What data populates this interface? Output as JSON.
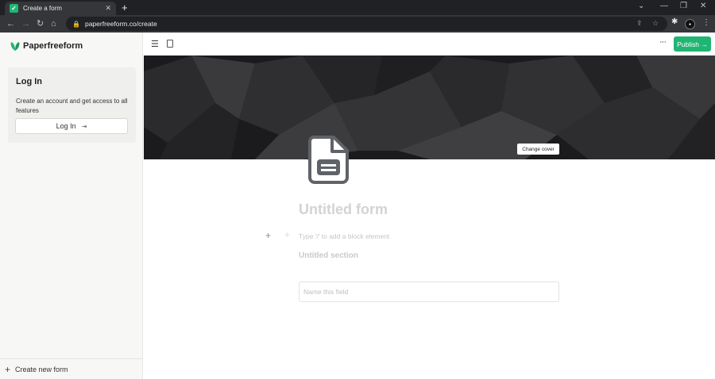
{
  "browser": {
    "tab_title": "Create a form",
    "tab_close": "✕",
    "new_tab": "+",
    "url": "paperfreeform.co/create",
    "window_controls": [
      "⌄",
      "—",
      "❐",
      "✕"
    ]
  },
  "sidebar": {
    "brand": "Paperfreeform",
    "login_card": {
      "title": "Log In",
      "description": "Create an account and get access to all features",
      "button_label": "Log In"
    },
    "footer_label": "Create new form"
  },
  "topbar": {
    "publish_label": "Publish →",
    "more": "···"
  },
  "cover": {
    "change_cover_label": "Change cover"
  },
  "form": {
    "title_placeholder": "Untitled form",
    "block_placeholder": "Type '/' to add a block element",
    "section_title": "Untitled section",
    "field_placeholder": "Name this field"
  },
  "colors": {
    "accent": "#21b573",
    "browser_dark": "#202124",
    "sidebar_bg": "#f7f7f5"
  }
}
